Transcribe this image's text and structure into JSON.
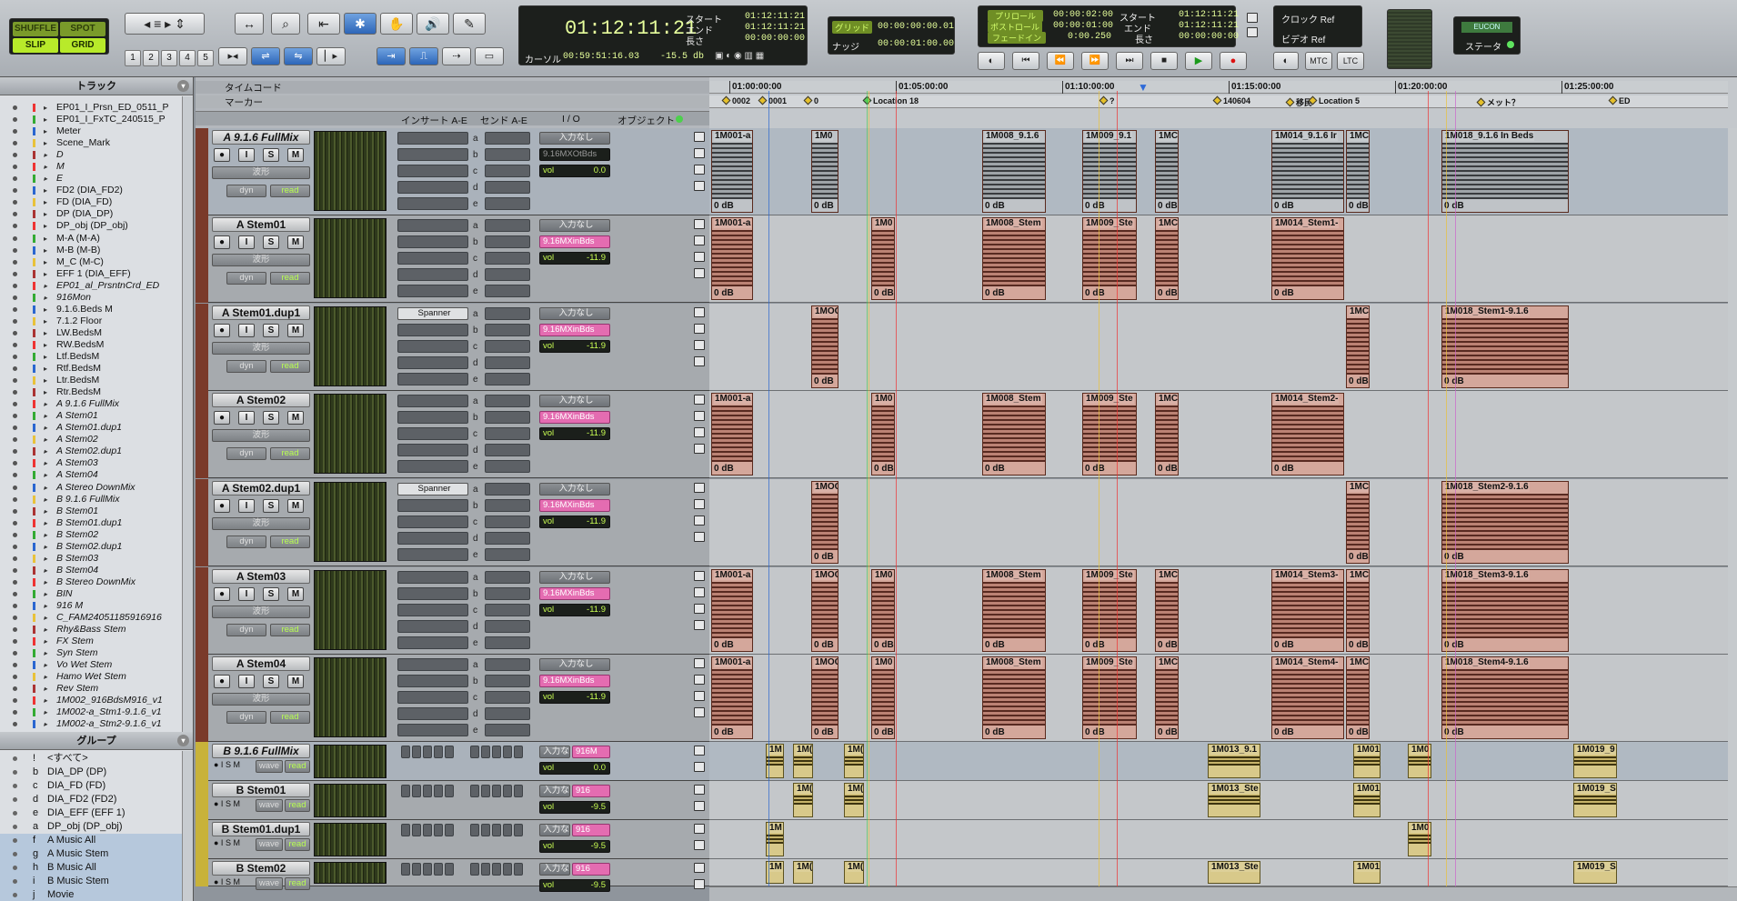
{
  "toolbar": {
    "modes": [
      "SHUFFLE",
      "SPOT",
      "SLIP",
      "GRID"
    ],
    "zoom_presets": [
      "1",
      "2",
      "3",
      "4",
      "5"
    ],
    "counter": {
      "main": "01:12:11:21",
      "start_label": "スタート",
      "end_label": "エンド",
      "length_label": "長さ",
      "start": "01:12:11:21",
      "end": "01:12:11:21",
      "length": "00:00:00:00",
      "cursor_label": "カーソル",
      "cursor": "00:59:51:16.03",
      "level": "-15.5 db"
    },
    "grid": {
      "label": "グリッド",
      "value": "00:00:00:00.01",
      "nudge_label": "ナッジ",
      "nudge": "00:00:01:00.00"
    },
    "transport": {
      "preroll_label": "プリロール",
      "postroll_label": "ポストロール",
      "fadein_label": "フェードイン",
      "preroll": "00:00:02:00",
      "postroll": "00:00:01:00",
      "fadein": "0:00.250",
      "start_label": "スタート",
      "end_label": "エンド",
      "length_label": "長さ",
      "start": "01:12:11:21",
      "end": "01:12:11:21",
      "length": "00:00:00:00"
    },
    "sync": {
      "clock": "クロック Ref",
      "video": "ビデオ Ref",
      "mtc": "MTC",
      "ltc": "LTC"
    },
    "eucon": {
      "label": "EUCON",
      "status": "ステータ"
    }
  },
  "tracks_panel": {
    "title": "トラック",
    "items": [
      "EP01_I_Prsn_ED_0511_P",
      "EP01_I_FxTC_240515_P",
      "Meter",
      "Scene_Mark",
      "D",
      "M",
      "E",
      "FD2 (DIA_FD2)",
      "FD (DIA_FD)",
      "DP (DIA_DP)",
      "DP_obj (DP_obj)",
      "M-A (M-A)",
      "M-B (M-B)",
      "M_C (M-C)",
      "EFF 1 (DIA_EFF)",
      "EP01_al_PrsntnCrd_ED",
      "916Mon",
      "9.1.6.Beds M",
      "7.1.2 Floor",
      "LW.BedsM",
      "RW.BedsM",
      "Ltf.BedsM",
      "Rtf.BedsM",
      "Ltr.BedsM",
      "Rtr.BedsM",
      "A 9.1.6 FullMix",
      "A Stem01",
      "A Stem01.dup1",
      "A Stem02",
      "A Stem02.dup1",
      "A Stem03",
      "A Stem04",
      "A Stereo DownMix",
      "B 9.1.6 FullMix",
      "B Stem01",
      "B Stem01.dup1",
      "B Stem02",
      "B Stem02.dup1",
      "B Stem03",
      "B Stem04",
      "B Stereo DownMix",
      "BIN",
      "916 M",
      "C_FAM24051185916916",
      "Rhy&Bass Stem",
      "FX Stem",
      "Syn Stem",
      "Vo Wet Stem",
      "Hamo Wet Stem",
      "Rev Stem",
      "1M002_916BdsM916_v1",
      "1M002-a_Stm1-9.1.6_v1",
      "1M002-a_Stm2-9.1.6_v1"
    ]
  },
  "groups_panel": {
    "title": "グループ",
    "items": [
      {
        "l": "!",
        "n": "<すべて>"
      },
      {
        "l": "b",
        "n": "DIA_DP (DP)"
      },
      {
        "l": "c",
        "n": "DIA_FD (FD)"
      },
      {
        "l": "d",
        "n": "DIA_FD2 (FD2)"
      },
      {
        "l": "e",
        "n": "DIA_EFF (EFF 1)"
      },
      {
        "l": "a",
        "n": "DP_obj (DP_obj)"
      },
      {
        "l": "f",
        "n": "A Music All"
      },
      {
        "l": "g",
        "n": "A Music Stem"
      },
      {
        "l": "h",
        "n": "B Music All"
      },
      {
        "l": "i",
        "n": "B Music Stem"
      },
      {
        "l": "j",
        "n": "Movie"
      }
    ]
  },
  "columns": {
    "insert": "インサート A-E",
    "send": "センド A-E",
    "io": "I / O",
    "object": "オブジェクト",
    "timecode": "タイムコード",
    "marker": "マーカー"
  },
  "ruler": {
    "times": [
      "01:00:00:00",
      "01:05:00:00",
      "01:10:00:00",
      "01:15:00:00",
      "01:20:00:00",
      "01:25:00:00"
    ],
    "markers": [
      "0002",
      "0001",
      "0",
      "Location 18",
      "?",
      "140604",
      "移民",
      "Location 5",
      "メット？",
      "ED"
    ]
  },
  "common": {
    "wave": "波形",
    "dyn": "dyn",
    "read": "read",
    "in_none": "入力なし",
    "vol": "vol",
    "spanner": "Spanner",
    "sends": [
      "a",
      "b",
      "c",
      "d",
      "e"
    ],
    "wave_short": "wave",
    "in_short": "入力な",
    "zero_db": "0 dB"
  },
  "a_tracks": [
    {
      "name": "A 9.1.6 FullMix",
      "out": "9.16MXOtBds",
      "vol": "0.0"
    },
    {
      "name": "A Stem01",
      "out": "9.16MXinBds",
      "vol": "-11.9"
    },
    {
      "name": "A Stem01.dup1",
      "out": "9.16MXinBds",
      "vol": "-11.9"
    },
    {
      "name": "A Stem02",
      "out": "9.16MXinBds",
      "vol": "-11.9"
    },
    {
      "name": "A Stem02.dup1",
      "out": "9.16MXinBds",
      "vol": "-11.9"
    },
    {
      "name": "A Stem03",
      "out": "9.16MXinBds",
      "vol": "-11.9"
    },
    {
      "name": "A Stem04",
      "out": "9.16MXinBds",
      "vol": "-11.9"
    }
  ],
  "b_tracks": [
    {
      "name": "B 9.1.6 FullMix",
      "out": "916M",
      "vol": "0.0"
    },
    {
      "name": "B Stem01",
      "out": "916",
      "vol": "-9.5"
    },
    {
      "name": "B Stem01.dup1",
      "out": "916",
      "vol": "-9.5"
    },
    {
      "name": "B Stem02",
      "out": "916",
      "vol": "-9.5"
    }
  ],
  "clips": {
    "full": [
      "1M001-a",
      "1M0",
      "1M008_9.1.6",
      "1M009_9.1",
      "1MC",
      "1M014_9.1.6 Ir",
      "1MC",
      "1M018_9.1.6 In Beds"
    ],
    "s1": [
      "1M001-a",
      "1M0",
      "1M008_Stem",
      "1M009_Ste",
      "1MC",
      "1M014_Stem1-"
    ],
    "s1d": [
      "1MOC",
      "1MC",
      "1M018_Stem1-9.1.6"
    ],
    "s2": [
      "1M001-a",
      "1M0",
      "1M008_Stem",
      "1M009_Ste",
      "1MC",
      "1M014_Stem2-"
    ],
    "s2d": [
      "1MOC",
      "1MC",
      "1M018_Stem2-9.1.6"
    ],
    "s3": [
      "1M001-a",
      "1MOC",
      "1M0",
      "1M008_Stem",
      "1M009_Ste",
      "1MC",
      "1M014_Stem3-",
      "1MC",
      "1M018_Stem3-9.1.6"
    ],
    "s4": [
      "1M001-a",
      "1MOC",
      "1M0",
      "1M008_Stem",
      "1M009_Ste",
      "1MC",
      "1M014_Stem4-",
      "1MC",
      "1M018_Stem4-9.1.6"
    ],
    "bfull": [
      "1M",
      "1M(",
      "1M(",
      "1M013_9.1",
      "1M01",
      "1M0",
      "1M019_9"
    ],
    "bs1": [
      "1M(",
      "1M(",
      "1M013_Ste",
      "1M01",
      "1M019_S"
    ],
    "bs1d": [
      "1M",
      "1M0"
    ],
    "bs2": [
      "1M",
      "1M(",
      "1M(",
      "1M013_Ste",
      "1M01",
      "1M019_S"
    ]
  }
}
